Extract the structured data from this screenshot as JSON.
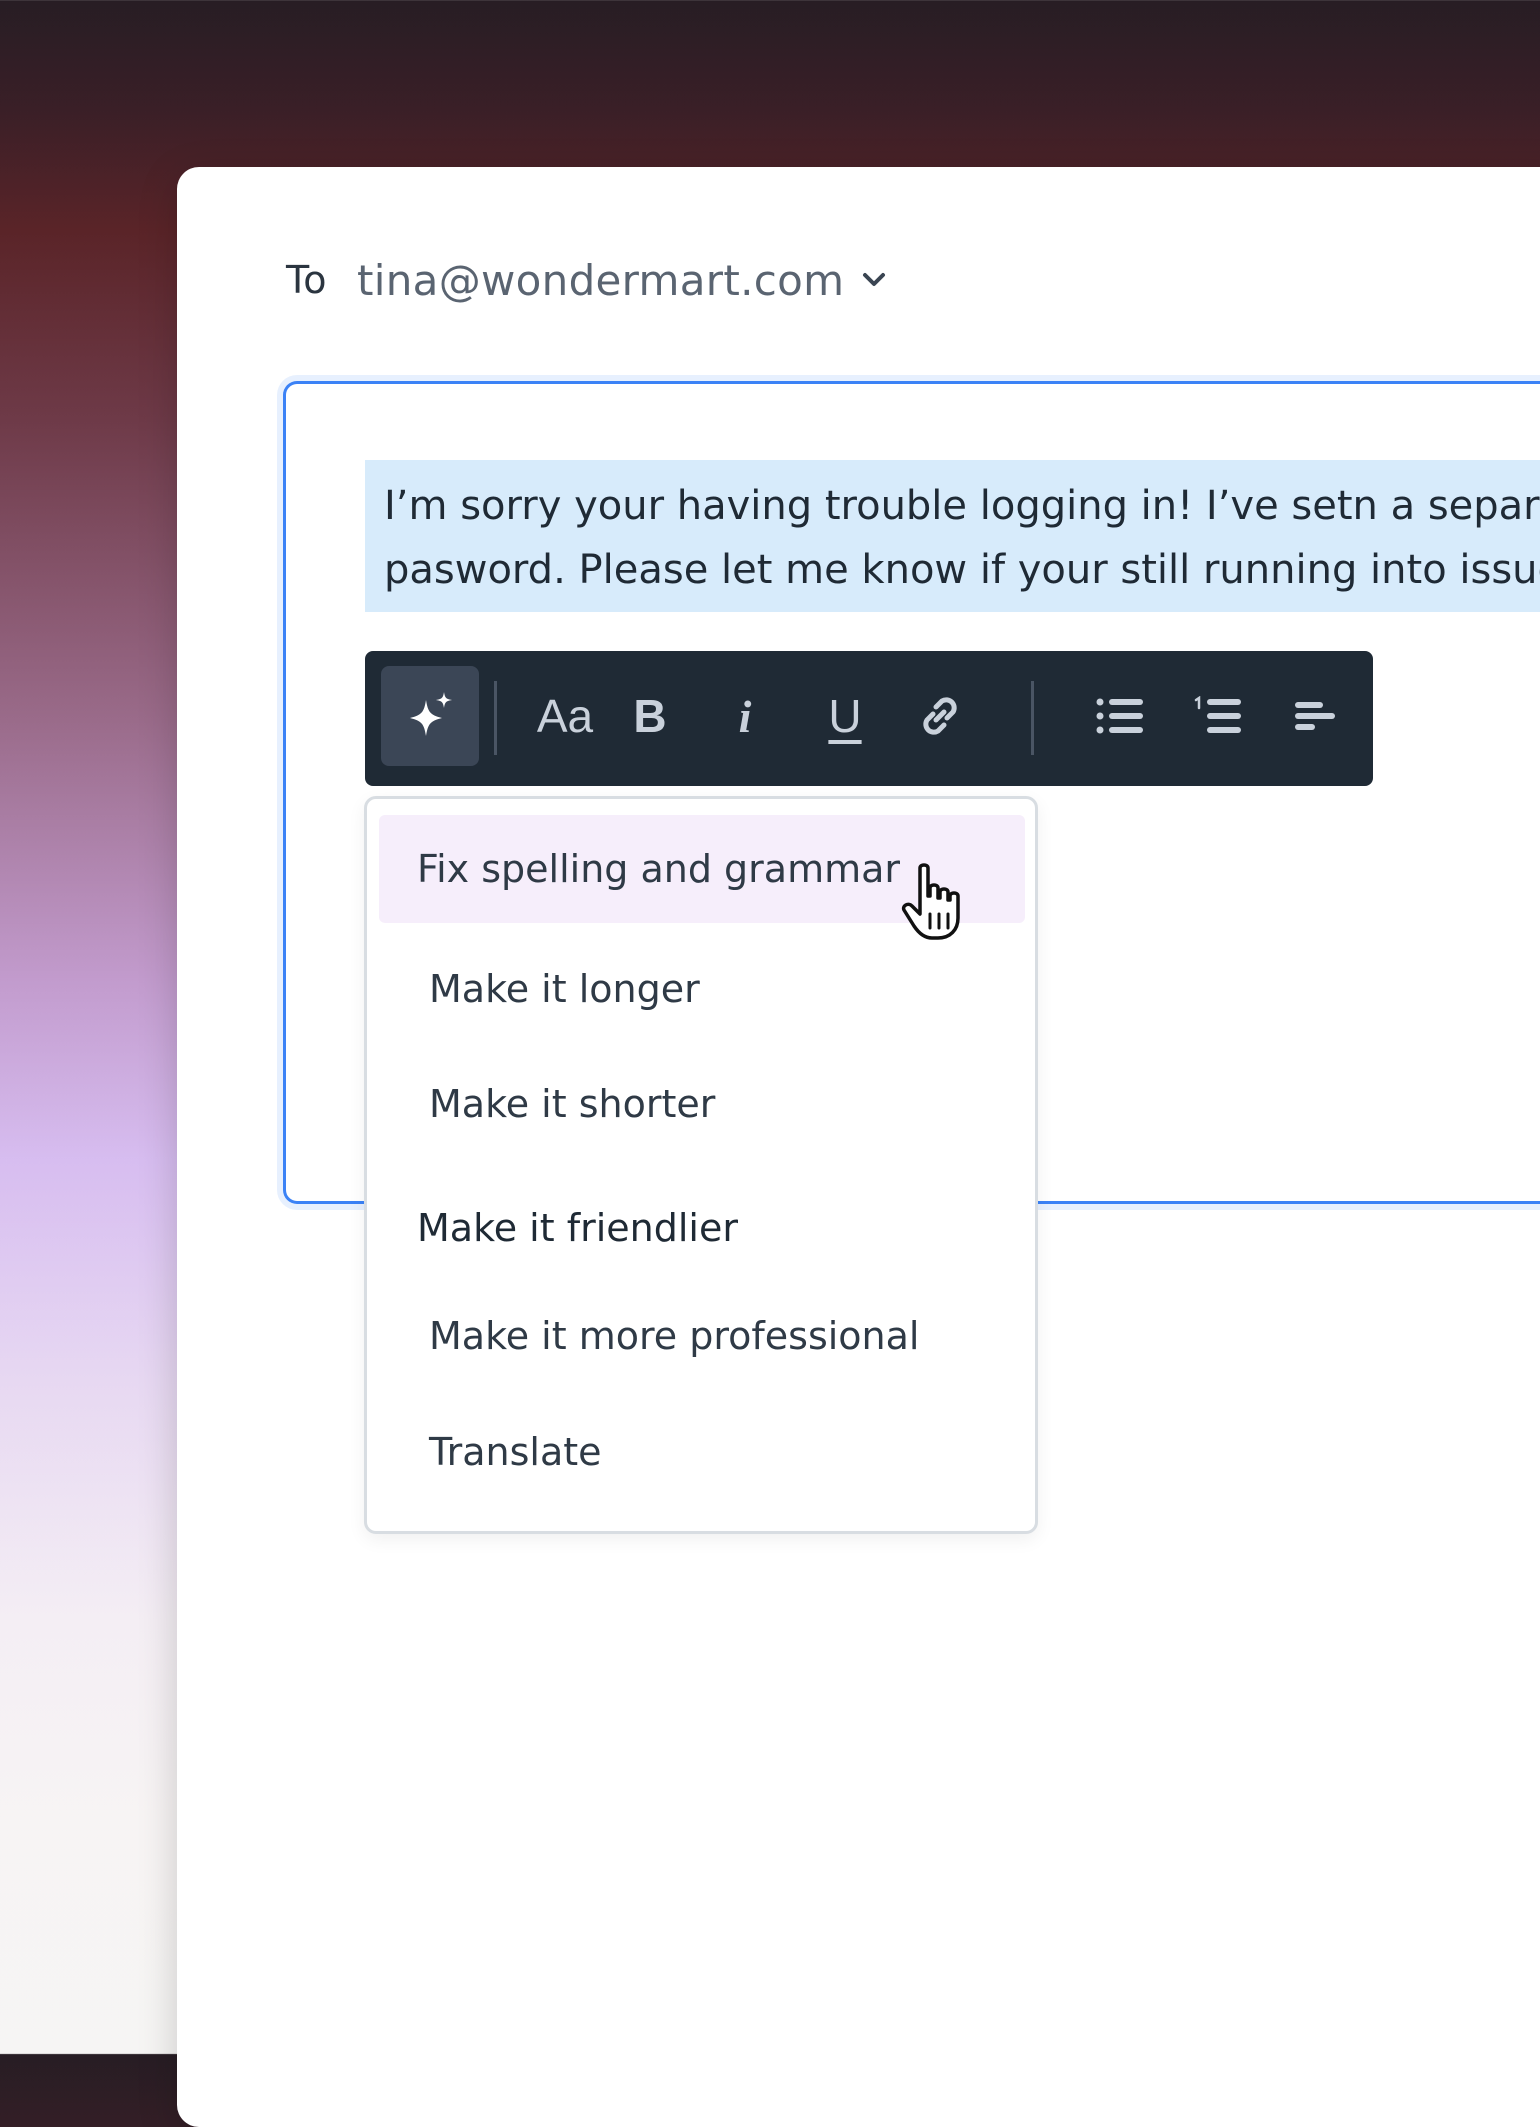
{
  "compose": {
    "to_label": "To",
    "to_address": "tina@wondermart.com",
    "selected_text_line1": "I’m sorry your having trouble logging in! I’ve setn a separat",
    "selected_text_line2": "pasword. Please let me know if your still running into issue"
  },
  "toolbar": {
    "ai_icon": "sparkle-icon",
    "font_size_label": "Aa",
    "bold_label": "B",
    "italic_label": "i",
    "underline_label": "U",
    "link_icon": "link-icon",
    "bullet_list_icon": "bulleted-list-icon",
    "numbered_list_icon": "numbered-list-icon",
    "align_icon": "align-left-icon"
  },
  "ai_menu": {
    "items": [
      {
        "label": "Fix spelling and grammar"
      },
      {
        "label": "Make it longer"
      },
      {
        "label": "Make it shorter"
      },
      {
        "label": "Make it friendlier"
      },
      {
        "label": "Make it more professional"
      },
      {
        "label": "Translate"
      }
    ]
  },
  "colors": {
    "accent": "#3b82f6",
    "toolbar_bg": "#1f2a35",
    "selection_bg": "#d7ebfb",
    "menu_hover_bg": "#f6eefb"
  }
}
